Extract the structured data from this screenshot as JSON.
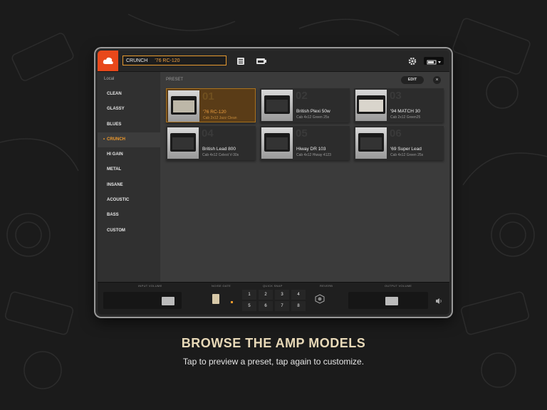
{
  "topbar": {
    "bank_label": "CRUNCH",
    "preset_name": "'76 RC-120"
  },
  "sidebar": {
    "header": "Local",
    "categories": [
      "CLEAN",
      "GLASSY",
      "BLUES",
      "CRUNCH",
      "HI GAIN",
      "METAL",
      "INSANE",
      "ACOUSTIC",
      "BASS",
      "CUSTOM"
    ],
    "selected": "CRUNCH"
  },
  "main": {
    "section_title": "PRESET",
    "edit_label": "EDIT",
    "close_label": "×",
    "presets": [
      {
        "number": "01",
        "name": "'76 RC-120",
        "cab": "Cab 2x12 Jazz Clean",
        "selected": true
      },
      {
        "number": "02",
        "name": "British Plexi 50w",
        "cab": "Cab 4x12 Green 25s"
      },
      {
        "number": "03",
        "name": "'94 MATCH 30",
        "cab": "Cab 2x12 Green25"
      },
      {
        "number": "04",
        "name": "British Lead 800",
        "cab": "Cab 4x12 Celest V-30s"
      },
      {
        "number": "05",
        "name": "Hiway DR 103",
        "cab": "Cab 4x12 Hiway 4123"
      },
      {
        "number": "06",
        "name": "'69 Super Lead",
        "cab": "Cab 4x12 Green 25s"
      }
    ]
  },
  "bottombar": {
    "input_volume": "INPUT VOLUME",
    "noise_gate": "NOISE GATE",
    "quick_snap": "QUICK SNAP",
    "reverb": "REVERB",
    "output_volume": "OUTPUT VOLUME",
    "keys": [
      "1",
      "2",
      "3",
      "4",
      "5",
      "6",
      "7",
      "8"
    ]
  },
  "caption": {
    "title": "BROWSE THE AMP MODELS",
    "subtitle": "Tap to preview a preset, tap again to customize."
  },
  "colors": {
    "accent": "#e8481b",
    "highlight": "#f09a2c",
    "title": "#e8d9b8"
  }
}
